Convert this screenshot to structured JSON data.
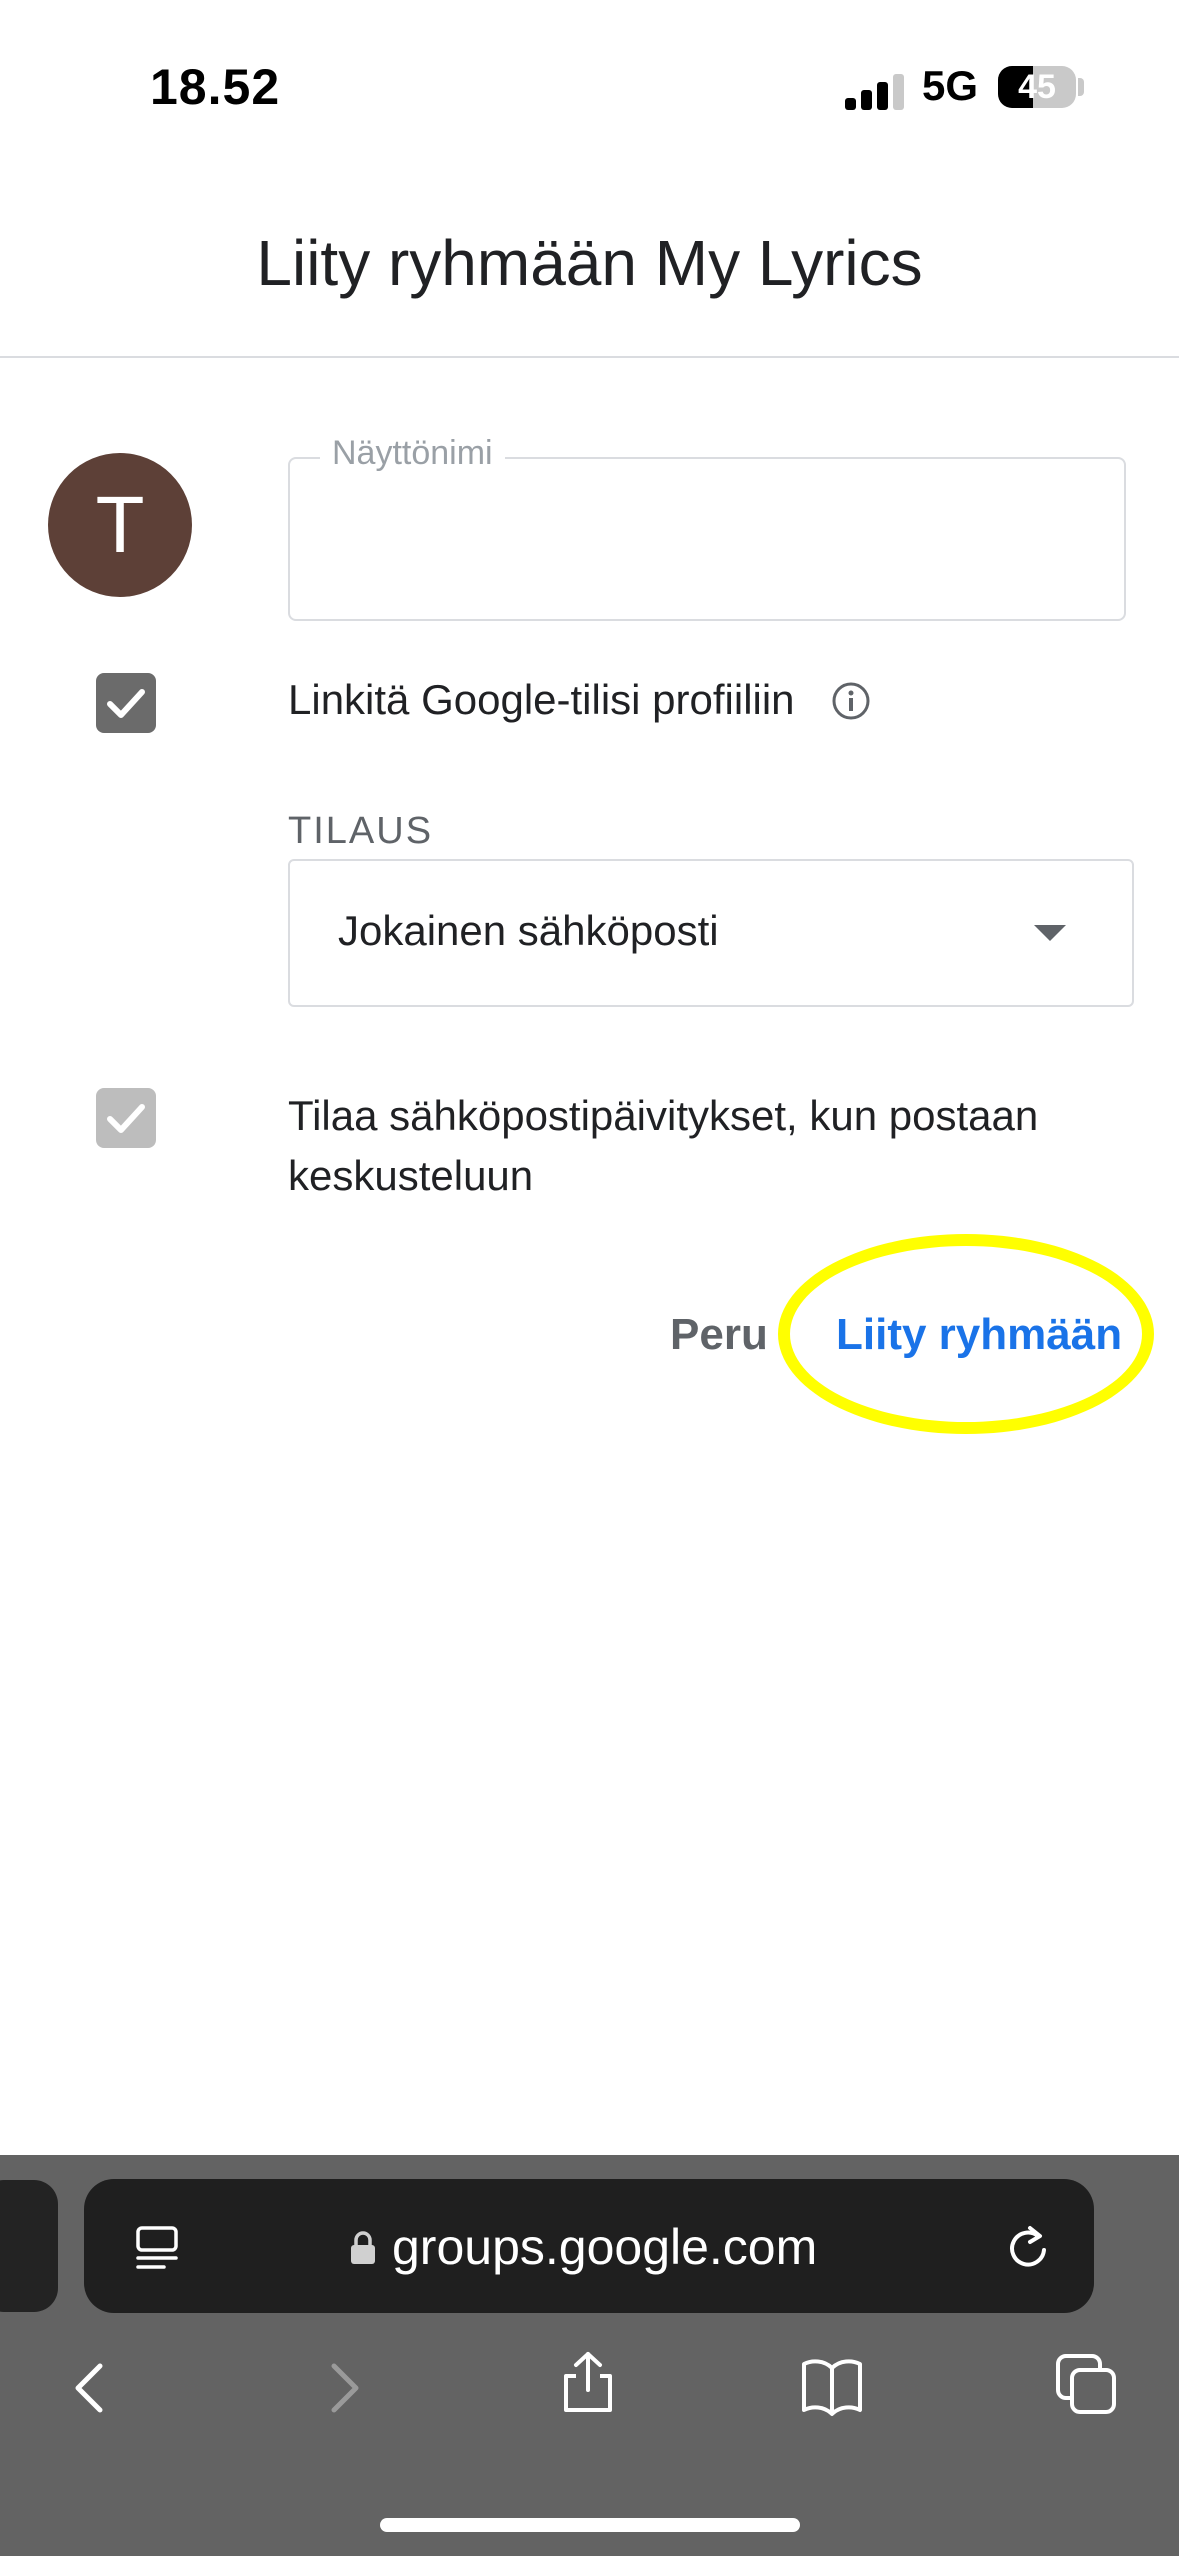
{
  "status_bar": {
    "time": "18.52",
    "network": "5G",
    "battery": "45",
    "battery_level": 0.45
  },
  "header": {
    "title": "Liity ryhmään My Lyrics"
  },
  "avatar": {
    "initial": "T",
    "color": "#5d4037"
  },
  "display_name": {
    "label": "Näyttönimi",
    "value": ""
  },
  "link_profile": {
    "checked": true,
    "label": "Linkitä Google-tilisi profiiliin",
    "icon": "info-icon"
  },
  "subscription": {
    "label": "TILAUS",
    "selected": "Jokainen sähköposti",
    "icon": "dropdown-arrow-icon"
  },
  "subscribe_updates": {
    "checked": true,
    "label": "Tilaa sähköpostipäivitykset, kun postaan keskusteluun"
  },
  "actions": {
    "cancel_label": "Peru",
    "join_label": "Liity ryhmään",
    "accent": "#1a73e8",
    "highlight_color": "#ffff00"
  },
  "browser": {
    "url": "groups.google.com",
    "icons": [
      "page-menu-icon",
      "lock-icon",
      "reload-icon",
      "back-icon",
      "forward-icon",
      "share-icon",
      "bookmarks-icon",
      "tabs-icon"
    ]
  }
}
